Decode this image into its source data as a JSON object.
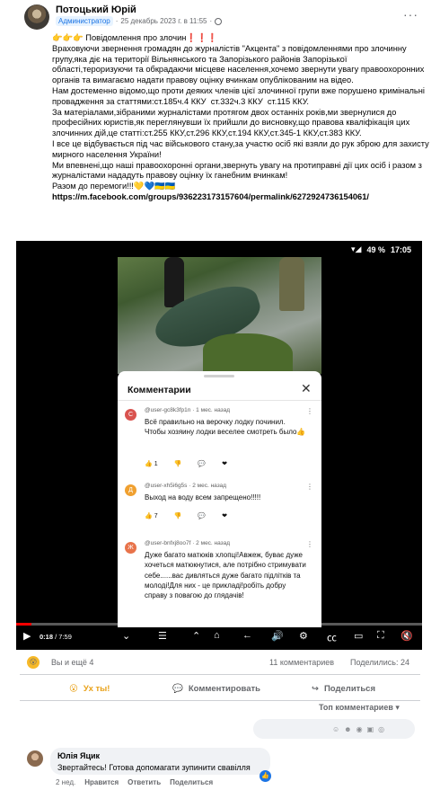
{
  "post": {
    "author": "Потоцький Юрій",
    "role": "Администратор",
    "timestamp": "25 декабрь 2023 г. в 11:55",
    "more_label": "···",
    "paragraphs": [
      "👉👉👉 Повідомлення про злочин❗❗❗",
      "Враховуючи звернення громадян до журналістів \"Акцента\" з повідомленнями про злочинну групу,яка діє на території Вільнянського та Запорізького районів Запорізької області,тероризуючи та обкрадаючи місцеве населення,хочемо звернути увагу правоохоронних органів та вимагаємо надати правову оцінку вчинкам опублікованим на відео.",
      "Нам достеменно відомо,що проти деяких членів цієї злочинної групи вже порушено кримінальні провадження за статтями:ст.185ч.4 ККУ  ст.332ч.3 ККУ  ст.115 ККУ.",
      "За матеріалами,зібраними журналістами протягом двох останніх років,ми звернулися до професійних юристів,як переглянувши їх прийшли до висновку,що правова кваліфікація цих злочинних дій,це статті:ст.255 ККУ,ст.296 ККУ,ст.194 ККУ,ст.345-1 ККУ,ст.383 ККУ.",
      "І все це відбувається під час військового стану,за участю осіб які взяли до рук зброю для захисту мирного населення України!",
      "Ми впевнені,що наші правоохоронні органи,звернуть увагу на протиправні дії цих осіб і разом з журналістами нададуть правову оцінку їх ганебним вчинкам!",
      "Разом до перемоги!!!💛💙🇺🇦🇺🇦"
    ],
    "link": "https://m.facebook.com/groups/936223173157604/permalink/6272924736154061/"
  },
  "video": {
    "status_bar": {
      "signal": "▾◢",
      "battery": "49 %",
      "clock": "17:05"
    },
    "current_time": "0:18",
    "duration": "7:59",
    "progress_fraction": 0.038,
    "comments_panel": {
      "title": "Комментарии",
      "close_label": "✕",
      "comments": [
        {
          "avatar_letter": "С",
          "avatar_color": "#d9534f",
          "meta": "@user-gc8k3fp1n · 1 мес. назад",
          "text": "Всё правильно на верочку лодку починил. Чтобы хозяину лодки веселее смотреть было👍",
          "likes": "1"
        },
        {
          "avatar_letter": "Д",
          "avatar_color": "#f0a030",
          "meta": "@user-xh5i6g5s · 2 мес. назад",
          "text": "Выход на воду всем запрещено!!!!!",
          "likes": "7"
        },
        {
          "avatar_letter": "Ж",
          "avatar_color": "#e8734a",
          "meta": "@user-bnfxj8oo7f · 2 мес. назад",
          "text": "Дуже багато матюків хлопці!Авжеж, буває дуже хочеться матюкнутися, але потрібно стримувати себе......вас дивляться дуже багато підлітків та молоді!Для них - це прикладі!робіть добру справу з повагою до глядачів!",
          "likes": ""
        }
      ]
    }
  },
  "stats": {
    "reaction_emoji": "😮",
    "reactions": "Вы и ещё 4",
    "comments": "11 комментариев",
    "shares": "Поделились: 24"
  },
  "actions": {
    "like": "Ух ты!",
    "comment": "Комментировать",
    "share": "Поделиться"
  },
  "sort_label": "Топ комментариев",
  "fb_comment": {
    "author": "Юлія Яцик",
    "text": "Звертайтесь! Готова допомагати зупинити свавілля",
    "time": "2 нед.",
    "like_label": "Нравится",
    "reply_label": "Ответить",
    "share_label": "Поделиться"
  },
  "colors": {
    "accent": "#1b74e4",
    "wow": "#e9a21a",
    "yt_red": "#ff0000"
  }
}
